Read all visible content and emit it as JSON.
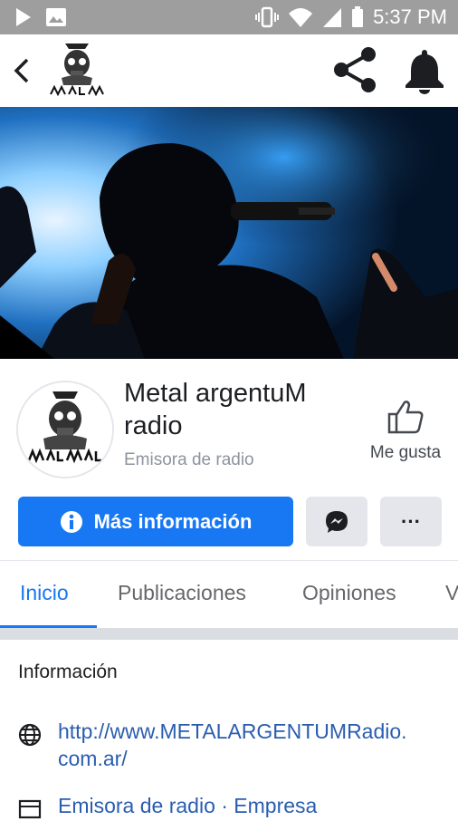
{
  "status": {
    "time": "5:37 PM"
  },
  "page": {
    "name": "Metal argentuM radio",
    "category": "Emisora de radio",
    "logo_text": "METALARGENTUM"
  },
  "actions": {
    "more_info": "Más información",
    "like": "Me gusta",
    "more_dots": "···"
  },
  "tabs": [
    {
      "label": "Inicio",
      "active": true
    },
    {
      "label": "Publicaciones",
      "active": false
    },
    {
      "label": "Opiniones",
      "active": false
    },
    {
      "label": "V",
      "active": false
    }
  ],
  "info": {
    "title": "Información",
    "website": "http://www.METALARGENTUMRadio.com.ar/",
    "website_line1": "http://www.METALARGENTUMRadio.",
    "website_line2": "com.ar/",
    "category_line": "Emisora de radio · Empresa"
  },
  "colors": {
    "accent": "#1877f2",
    "link": "#2a5db0",
    "statusbar": "#9e9e9e"
  }
}
